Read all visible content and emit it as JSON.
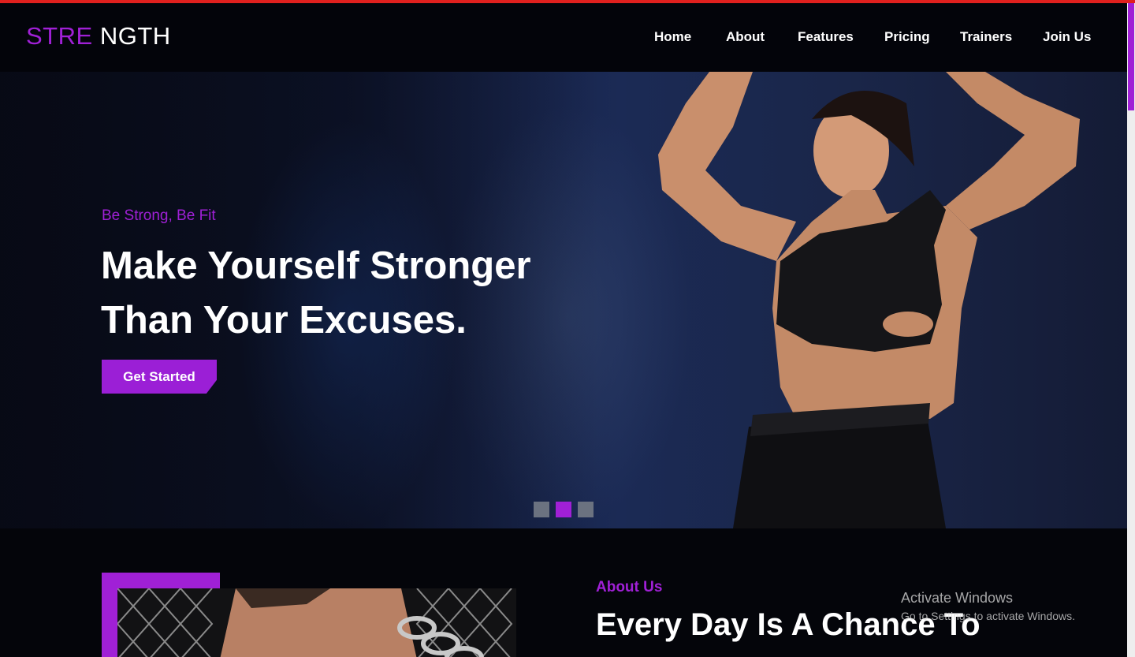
{
  "header": {
    "logo_part1": "STRE",
    "logo_part2": "NGTH",
    "nav": [
      "Home",
      "About",
      "Features",
      "Pricing",
      "Trainers",
      "Join Us"
    ]
  },
  "hero": {
    "subtitle": "Be Strong, Be Fit",
    "headline_line1": "Make Yourself Stronger",
    "headline_line2": "Than Your Excuses.",
    "cta_label": "Get Started",
    "slides_total": 3,
    "active_slide": 2
  },
  "about": {
    "label": "About Us",
    "title": "Every Day Is A Chance To"
  },
  "watermark": {
    "line1": "Activate Windows",
    "line2": "Go to Settings to activate Windows."
  },
  "colors": {
    "accent": "#a020d6",
    "background": "#04050a",
    "top_strip": "#e0201e"
  }
}
